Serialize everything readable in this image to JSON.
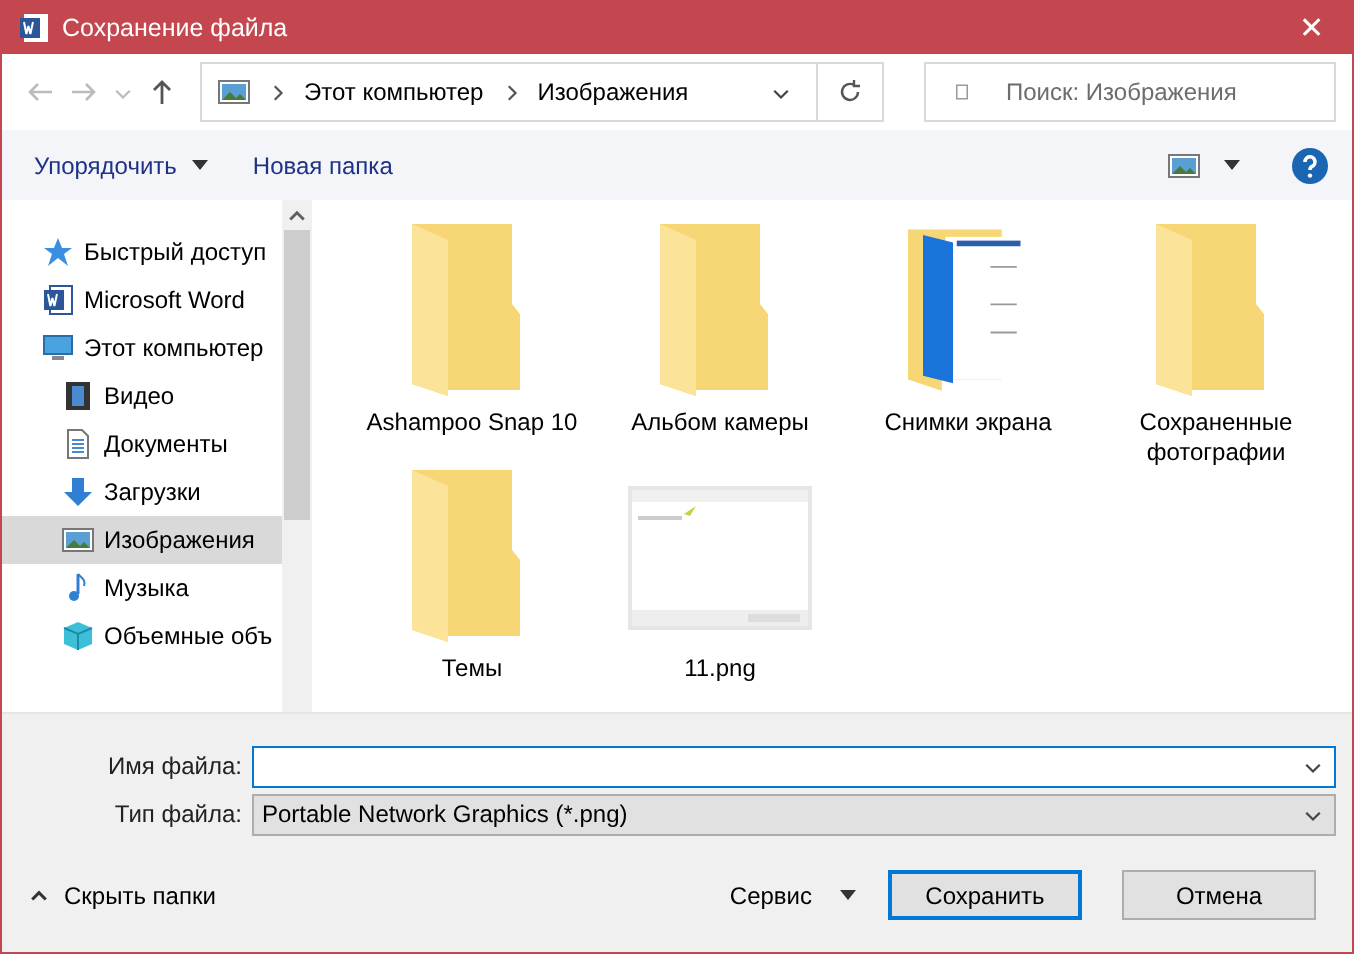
{
  "window": {
    "title": "Сохранение файла",
    "close": "✕"
  },
  "nav": {
    "path": [
      "Этот компьютер",
      "Изображения"
    ],
    "search": {
      "placeholder": "Поиск: Изображения"
    }
  },
  "toolbar": {
    "organize": "Упорядочить",
    "new_folder": "Новая папка"
  },
  "sidebar": {
    "items": [
      {
        "label": "Быстрый доступ",
        "kind": "star",
        "selected": false
      },
      {
        "label": "Microsoft Word",
        "kind": "word",
        "selected": false
      },
      {
        "label": "Этот компьютер",
        "kind": "pc",
        "selected": false,
        "children": [
          {
            "label": "Видео",
            "kind": "video",
            "selected": false
          },
          {
            "label": "Документы",
            "kind": "docs",
            "selected": false
          },
          {
            "label": "Загрузки",
            "kind": "download",
            "selected": false
          },
          {
            "label": "Изображения",
            "kind": "pictures",
            "selected": true
          },
          {
            "label": "Музыка",
            "kind": "music",
            "selected": false
          },
          {
            "label": "Объемные объ",
            "kind": "cube",
            "selected": false
          }
        ]
      }
    ]
  },
  "files": [
    {
      "name": "Ashampoo Snap 10",
      "kind": "folder"
    },
    {
      "name": "Альбом камеры",
      "kind": "folder"
    },
    {
      "name": "Снимки экрана",
      "kind": "screens"
    },
    {
      "name": "Сохраненные фотографии",
      "kind": "folder"
    },
    {
      "name": "Темы",
      "kind": "folder"
    },
    {
      "name": "11.png"
    }
  ],
  "form": {
    "filename_label": "Имя файла:",
    "type_label": "Тип файла:",
    "type": "Portable Network Graphics (*.png)"
  },
  "footer": {
    "hide_folders": "Скрыть папки",
    "tools": "Сервис",
    "save": "Сохранить",
    "cancel": "Отмена"
  }
}
